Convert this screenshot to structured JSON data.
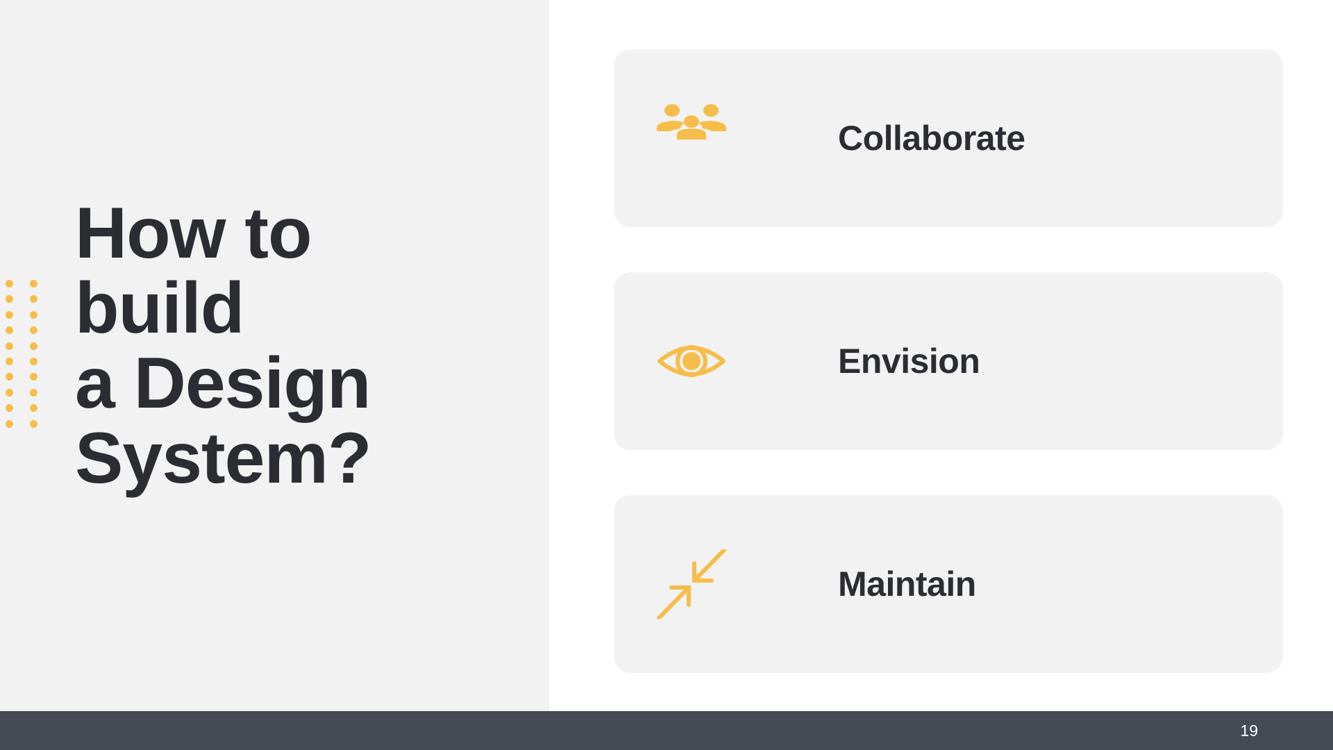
{
  "slide": {
    "title_lines": [
      "How to",
      "build",
      "a Design",
      "System?"
    ],
    "page_number": "19",
    "accent_color": "#f6bd4a"
  },
  "cards": [
    {
      "label": "Collaborate",
      "icon": "people-group-icon"
    },
    {
      "label": "Envision",
      "icon": "eye-icon"
    },
    {
      "label": "Maintain",
      "icon": "arrows-inward-icon"
    }
  ]
}
